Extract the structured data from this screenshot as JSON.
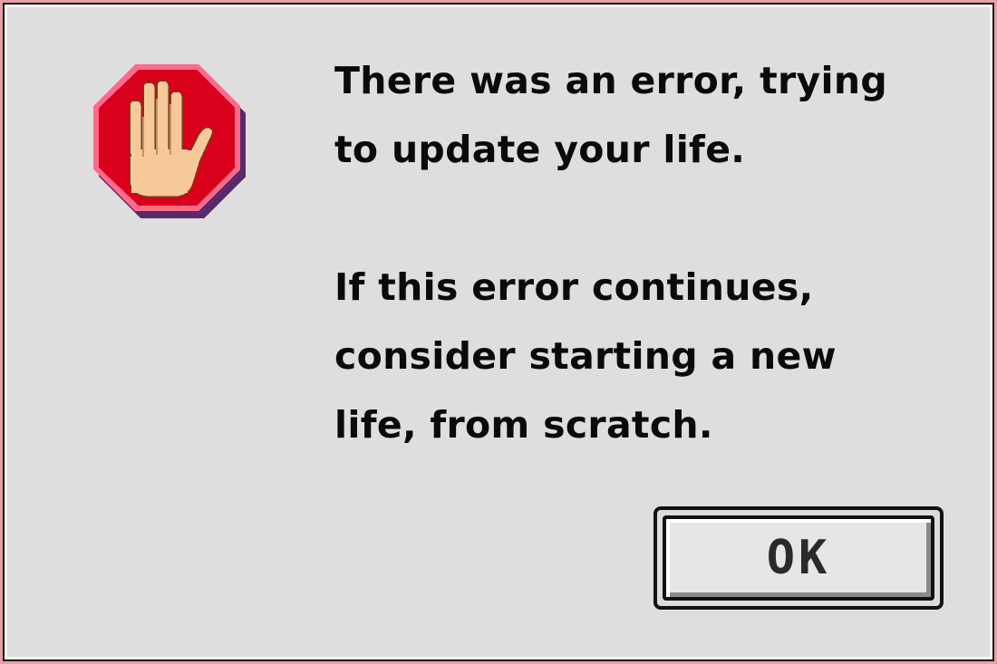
{
  "dialog": {
    "icon": "stop-hand-icon",
    "message_line_1": "There was an error, trying",
    "message_line_2": "to update your life.",
    "message_line_3": "If this error continues,",
    "message_line_4": "consider starting a new",
    "message_line_5": "life, from scratch.",
    "ok_label": "OK"
  },
  "colors": {
    "background": "#dedede",
    "stop_red": "#d9001b",
    "skin": "#f5c99a",
    "outer_border": "#e8a0a8"
  }
}
